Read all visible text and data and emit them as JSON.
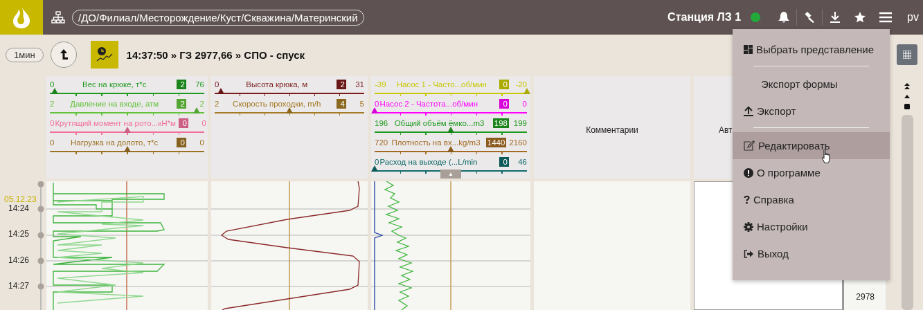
{
  "top_bar": {
    "path": "/ДО/Филиал/Месторождение/Куст/Скважина/Материнский",
    "station": "Станция ЛЗ 1",
    "connected": true,
    "user": "pv"
  },
  "toolbar": {
    "interval": "1мин",
    "status_text": "14:37:50 » ГЗ 2977,66 » СПО - спуск"
  },
  "tracks": [
    {
      "params": [
        {
          "min": "0",
          "name": "Вес на крюке, т*с",
          "value": "2",
          "max": "76",
          "color": "#1f9a1f",
          "level": 0.03
        },
        {
          "min": "2",
          "name": "Давление на входе, атм",
          "value": "2",
          "max": "2",
          "color": "#63c23c",
          "level": 0.95
        },
        {
          "min": "0",
          "name": "Крутящий момент на рото...кН*м",
          "value": "0",
          "max": "0",
          "color": "#f0709a",
          "level": 0.5
        },
        {
          "min": "0",
          "name": "Нагрузка на долото, т*с",
          "value": "0",
          "max": "0",
          "color": "#9c7222",
          "level": 0.5
        }
      ]
    },
    {
      "params": [
        {
          "min": "0",
          "name": "Высота крюка, м",
          "value": "2",
          "max": "31",
          "color": "#7a1a1a",
          "level": 0.04
        },
        {
          "min": "2",
          "name": "Скорость проходки, m/h",
          "value": "4",
          "max": "5",
          "color": "#a47a22",
          "level": 0.5
        }
      ]
    },
    {
      "params": [
        {
          "min": "-39",
          "name": "Насос 1 - Часто...об/мин",
          "value": "0",
          "max": "-20",
          "color": "#c8c800",
          "level": 1
        },
        {
          "min": "0",
          "name": "Насос 2 - Частота...об/мин",
          "value": "0",
          "max": "0",
          "color": "#ff00ff",
          "level": 0
        },
        {
          "min": "196",
          "name": "Общий объём ёмко...m3",
          "value": "198",
          "max": "199",
          "color": "#1f9a1f",
          "level": 0.5
        },
        {
          "min": "720",
          "name": "Плотность на вх...kg/m3",
          "value": "1440",
          "max": "2160",
          "color": "#a46a22",
          "level": 0.5
        },
        {
          "min": "0",
          "name": "Расход на выходе (...L/min",
          "value": "0",
          "max": "46",
          "color": "#106a6a",
          "level": 0
        }
      ],
      "collapse_button": "▲"
    }
  ],
  "comments": {
    "title": "Комментарии"
  },
  "auto_operations": {
    "title": "Авт"
  },
  "depth": {
    "values": [
      "2978"
    ]
  },
  "time_axis": {
    "date": "05.12.23",
    "ticks": [
      "14:24",
      "14:25",
      "14:26",
      "14:27"
    ]
  },
  "menu": {
    "items": [
      {
        "kind": "view",
        "label": "Выбрать представление",
        "highlighted": false
      },
      {
        "kind": "separator"
      },
      {
        "kind": "plain",
        "label": "Экспорт формы",
        "highlighted": false
      },
      {
        "kind": "export",
        "label": "Экспорт",
        "highlighted": false
      },
      {
        "kind": "separator"
      },
      {
        "kind": "edit",
        "label": "Редактировать",
        "highlighted": true
      },
      {
        "kind": "about",
        "label": "О программе",
        "highlighted": false
      },
      {
        "kind": "help",
        "label": "Справка",
        "highlighted": false
      },
      {
        "kind": "settings",
        "label": "Настройки",
        "highlighted": false
      },
      {
        "kind": "logout",
        "label": "Выход",
        "highlighted": false
      }
    ]
  }
}
